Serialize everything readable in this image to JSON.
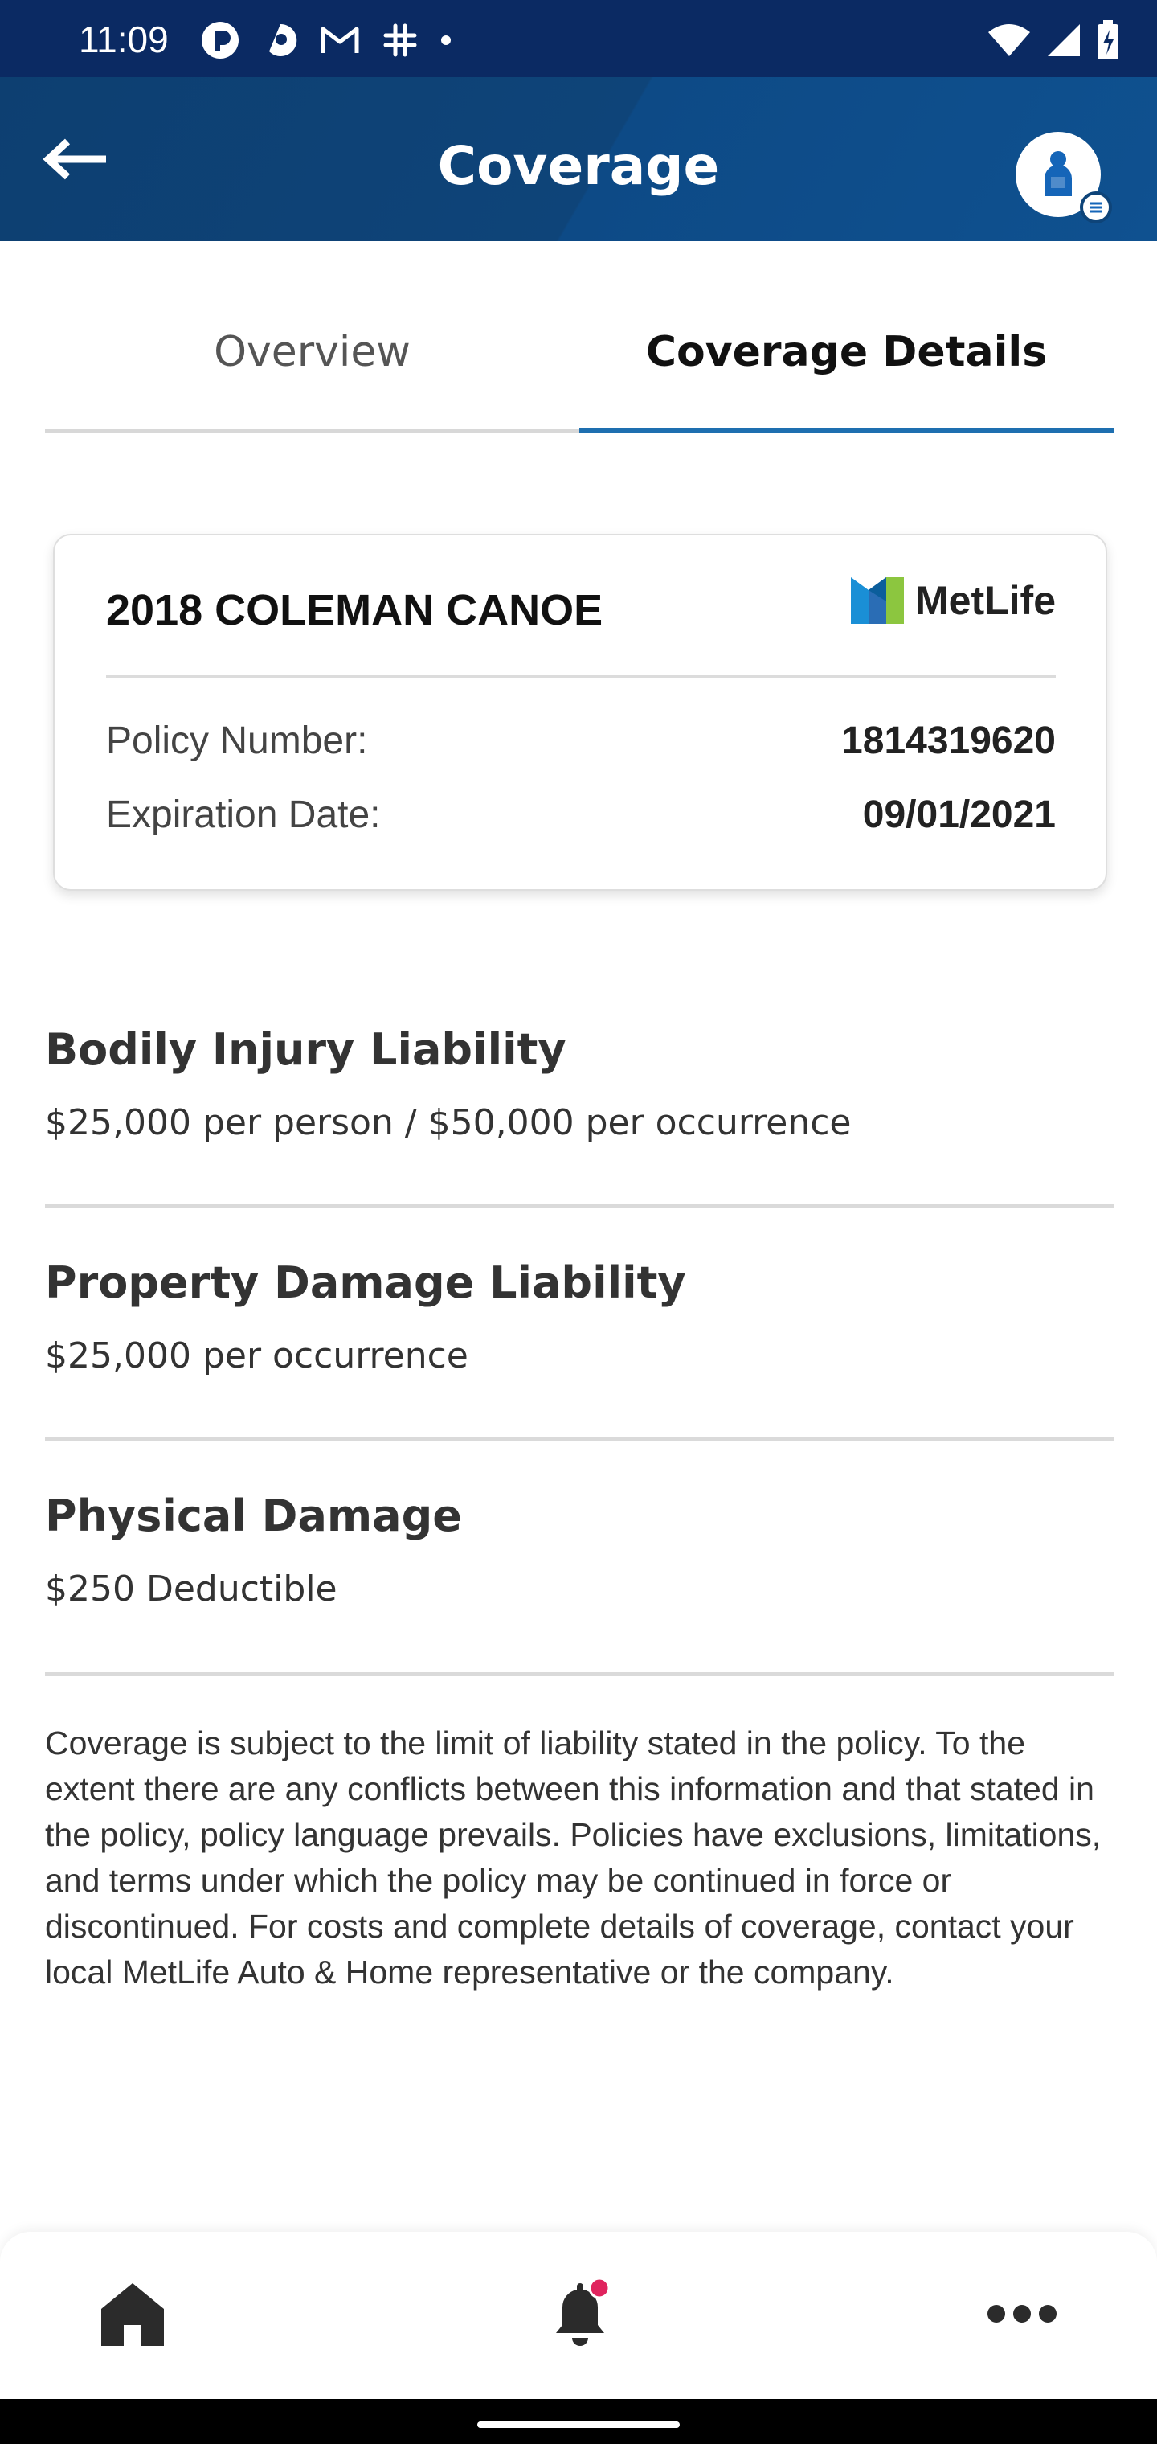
{
  "status_bar": {
    "time": "11:09",
    "left_icons": [
      "app-icon",
      "app-icon",
      "gmail-icon",
      "slack-icon",
      "dot-icon"
    ],
    "right_icons": [
      "wifi-icon",
      "signal-icon",
      "battery-icon"
    ]
  },
  "header": {
    "title": "Coverage",
    "back_icon": "arrow-left-icon",
    "avatar_icon": "user-profile-icon"
  },
  "tabs": [
    {
      "label": "Overview",
      "active": false
    },
    {
      "label": "Coverage Details",
      "active": true
    }
  ],
  "policy_card": {
    "title": "2018 COLEMAN CANOE",
    "logo_text": "MetLife",
    "policy_number_label": "Policy Number:",
    "policy_number": "1814319620",
    "expiration_label": "Expiration Date:",
    "expiration_date": "09/01/2021"
  },
  "coverages": [
    {
      "title": "Bodily Injury Liability",
      "value": "$25,000 per person / $50,000 per occurrence"
    },
    {
      "title": "Property Damage Liability",
      "value": "$25,000 per occurrence"
    },
    {
      "title": "Physical Damage",
      "value": "$250 Deductible"
    }
  ],
  "disclaimer": "Coverage is subject to the limit of liability stated in the policy. To the extent there are any conflicts between this information and that stated in the policy, policy language prevails. Policies have exclusions, limitations, and terms under which the policy may be continued in force or discontinued. For costs and complete details of coverage, contact your local MetLife Auto & Home representative or the company.",
  "bottom_nav": {
    "items": [
      "home-icon",
      "notifications-bell-icon",
      "more-icon"
    ],
    "notification_dot_color": "#e0245e"
  },
  "colors": {
    "header_bg": "#0e4479",
    "status_bar_bg": "#0b2a63",
    "tab_active_underline": "#1e6fb0",
    "metlife_blue": "#1a8fd6",
    "metlife_green": "#8cc63f"
  }
}
